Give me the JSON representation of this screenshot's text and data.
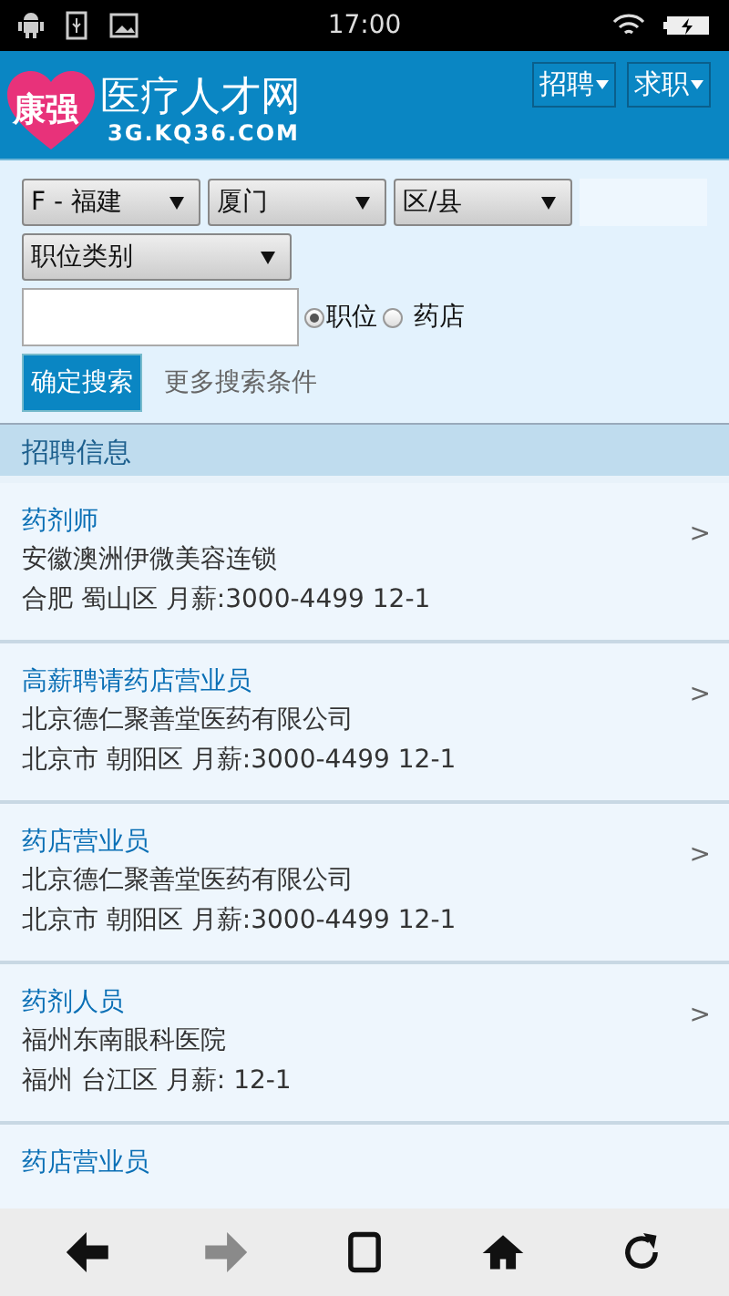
{
  "status_bar": {
    "time": "17:00"
  },
  "header": {
    "logo_badge": "康强",
    "logo_title": "医疗人才网",
    "logo_domain": "3G.KQ36.COM",
    "menus": [
      {
        "label": "招聘"
      },
      {
        "label": "求职"
      }
    ]
  },
  "search": {
    "selects": [
      {
        "value": "F - 福建"
      },
      {
        "value": "厦门"
      },
      {
        "value": "区/县"
      },
      {
        "value": "职位类别"
      }
    ],
    "scope": [
      {
        "label": "职位",
        "selected": true
      },
      {
        "label": "药店",
        "selected": false
      }
    ],
    "submit": "确定搜索",
    "more": "更多搜索条件"
  },
  "section_title": "招聘信息",
  "jobs": [
    {
      "title": "药剂师",
      "company": "安徽澳洲伊微美容连锁",
      "detail": "合肥 蜀山区 月薪:3000-4499 12-1",
      "arrow": ">"
    },
    {
      "title": "高薪聘请药店营业员",
      "company": "北京德仁聚善堂医药有限公司",
      "detail": "北京市 朝阳区 月薪:3000-4499 12-1",
      "arrow": ">"
    },
    {
      "title": "药店营业员",
      "company": "北京德仁聚善堂医药有限公司",
      "detail": "北京市 朝阳区 月薪:3000-4499 12-1",
      "arrow": ">"
    },
    {
      "title": "药剂人员",
      "company": "福州东南眼科医院",
      "detail": "福州 台江区 月薪: 12-1",
      "arrow": ">"
    },
    {
      "title": "药店营业员"
    }
  ],
  "toolbar": [
    {
      "kind": "back",
      "disabled": false
    },
    {
      "kind": "forward",
      "disabled": true
    },
    {
      "kind": "tabs",
      "disabled": false
    },
    {
      "kind": "home",
      "disabled": false
    },
    {
      "kind": "refresh",
      "disabled": false
    }
  ]
}
